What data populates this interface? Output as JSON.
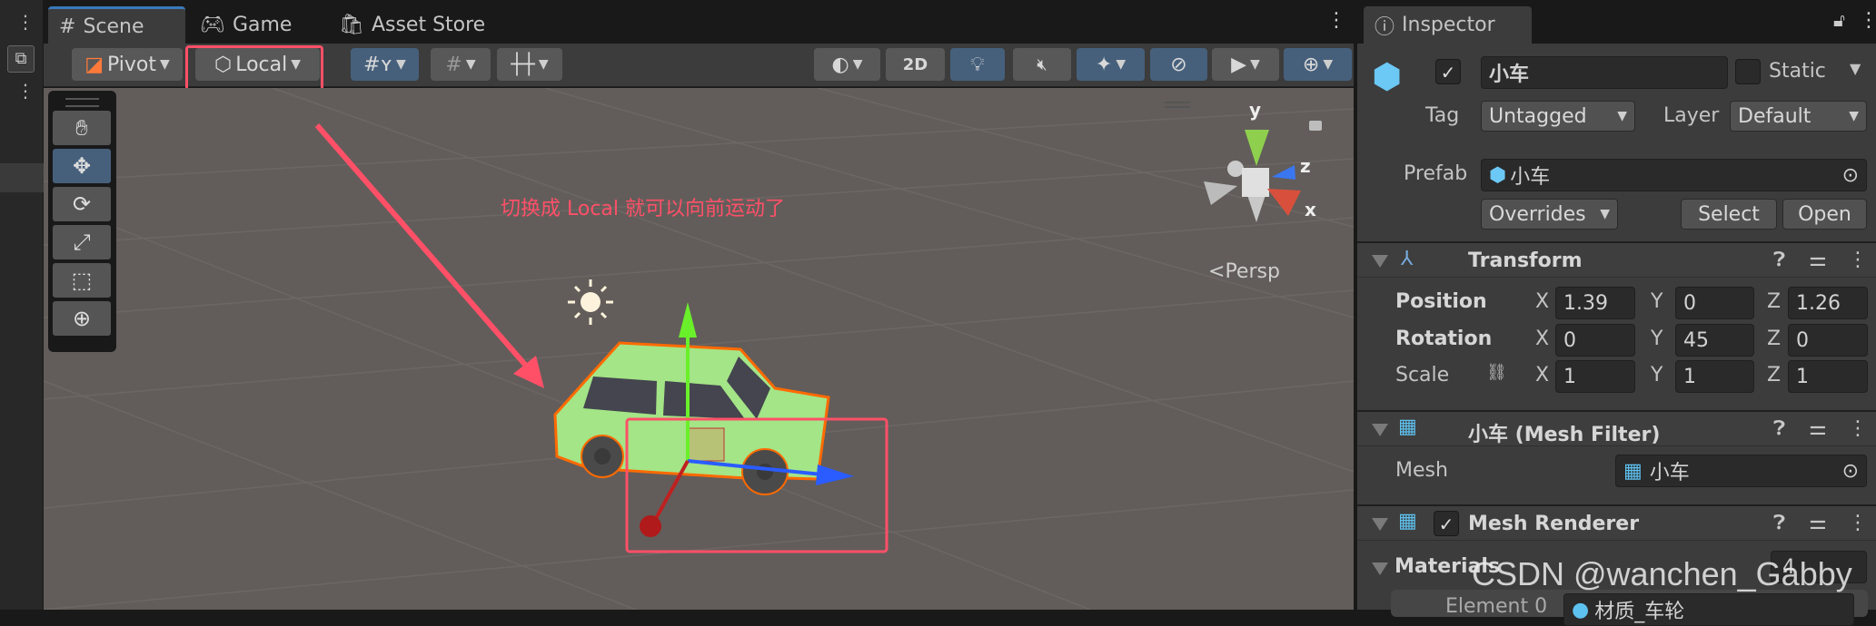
{
  "tabs": {
    "scene": "Scene",
    "game": "Game",
    "asset_store": "Asset Store"
  },
  "toolbar": {
    "pivot": "Pivot",
    "local": "Local",
    "mode_2d": "2D"
  },
  "scene": {
    "annotation": "切换成 Local 就可以向前运动了",
    "gizmo": {
      "y": "y",
      "z": "z",
      "x": "x",
      "projection": "Persp"
    }
  },
  "inspector": {
    "tab": "Inspector",
    "object_name": "小车",
    "active": true,
    "static_label": "Static",
    "tag_label": "Tag",
    "tag_value": "Untagged",
    "layer_label": "Layer",
    "layer_value": "Default",
    "prefab_label": "Prefab",
    "prefab_value": "小车",
    "overrides": "Overrides",
    "select": "Select",
    "open": "Open",
    "transform": {
      "title": "Transform",
      "position": {
        "label": "Position",
        "x": "1.39",
        "y": "0",
        "z": "1.26"
      },
      "rotation": {
        "label": "Rotation",
        "x": "0",
        "y": "45",
        "z": "0"
      },
      "scale": {
        "label": "Scale",
        "x": "1",
        "y": "1",
        "z": "1"
      },
      "axis_x": "X",
      "axis_y": "Y",
      "axis_z": "Z"
    },
    "mesh_filter": {
      "title": "小车 (Mesh Filter)",
      "mesh_label": "Mesh",
      "mesh_value": "小车"
    },
    "mesh_renderer": {
      "title": "Mesh Renderer",
      "materials_label": "Materials",
      "materials_count": "4",
      "element0_label": "Element 0",
      "element0_value": "材质_车轮"
    }
  },
  "watermark": "CSDN @wanchen_Gabby",
  "colors": {
    "annotation": "#ff5068",
    "accent": "#46607c",
    "scene_bg": "#625d5a",
    "car": "#a4e587",
    "outline": "#ff6a00"
  }
}
